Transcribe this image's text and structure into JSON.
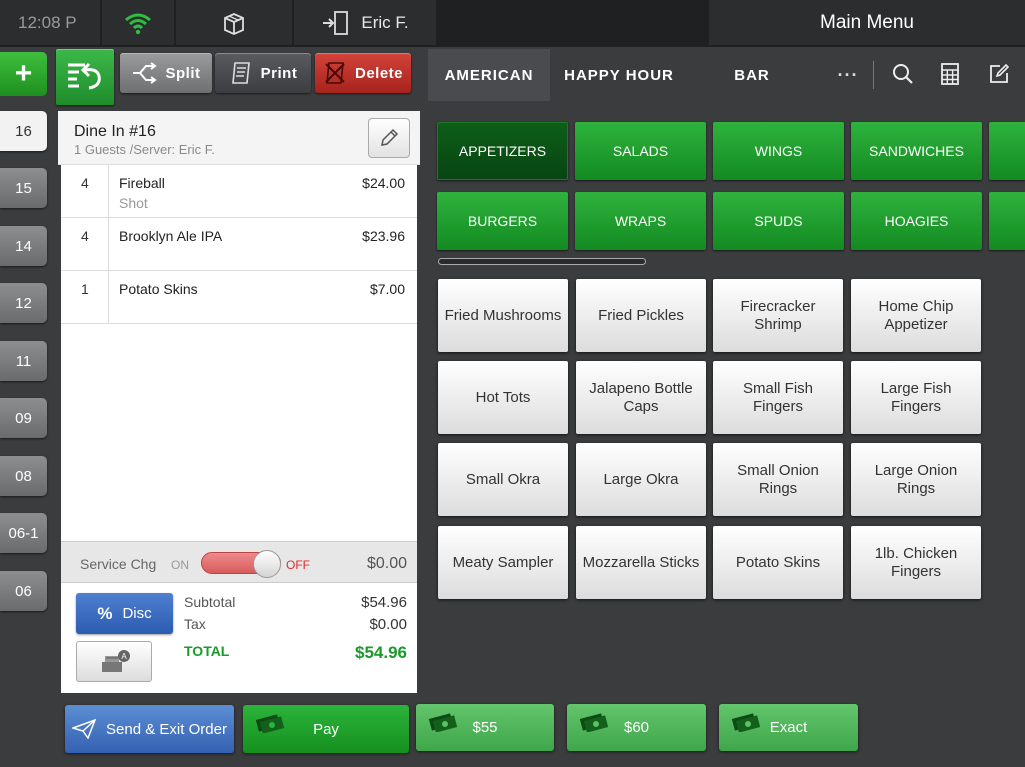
{
  "topbar": {
    "time": "12:08 P",
    "user": "Eric F.",
    "title": "Main Menu"
  },
  "tables": [
    "16",
    "15",
    "14",
    "12",
    "11",
    "09",
    "08",
    "06-1",
    "06"
  ],
  "ticket_toolbar": {
    "split_label": "Split",
    "print_label": "Print",
    "delete_label": "Delete"
  },
  "ticket": {
    "title": "Dine In #16",
    "subtitle": "1 Guests /Server: Eric F.",
    "items": [
      {
        "qty": "4",
        "name": "Fireball",
        "note": "Shot",
        "price": "$24.00"
      },
      {
        "qty": "4",
        "name": "Brooklyn Ale IPA",
        "note": "",
        "price": "$23.96"
      },
      {
        "qty": "1",
        "name": "Potato Skins",
        "note": "",
        "price": "$7.00"
      }
    ],
    "service": {
      "label": "Service Chg",
      "on": "ON",
      "off": "OFF",
      "amount": "$0.00"
    },
    "disc_label": "Disc",
    "subtotal_label": "Subtotal",
    "subtotal": "$54.96",
    "tax_label": "Tax",
    "tax": "$0.00",
    "total_label": "TOTAL",
    "total": "$54.96"
  },
  "categories": [
    "AMERICAN",
    "HAPPY HOUR",
    "BAR"
  ],
  "more_label": "···",
  "subcategories": [
    "APPETIZERS",
    "SALADS",
    "WINGS",
    "SANDWICHES",
    "BURGERS",
    "WRAPS",
    "SPUDS",
    "HOAGIES"
  ],
  "items": [
    "Fried Mushrooms",
    "Fried Pickles",
    "Firecracker Shrimp",
    "Home Chip Appetizer",
    "Hot Tots",
    "Jalapeno Bottle Caps",
    "Small Fish Fingers",
    "Large Fish Fingers",
    "Small Okra",
    "Large Okra",
    "Small Onion Rings",
    "Large Onion Rings",
    "Meaty Sampler",
    "Mozzarella Sticks",
    "Potato Skins",
    "1lb. Chicken Fingers"
  ],
  "bottom": {
    "send_label": "Send & Exit Order",
    "pay_label": "Pay",
    "q55_label": "$55",
    "q60_label": "$60",
    "exact_label": "Exact"
  },
  "colors": {
    "accent_green": "#1e9a2c",
    "delete_red": "#b82c24",
    "send_blue": "#3a6bbd"
  }
}
